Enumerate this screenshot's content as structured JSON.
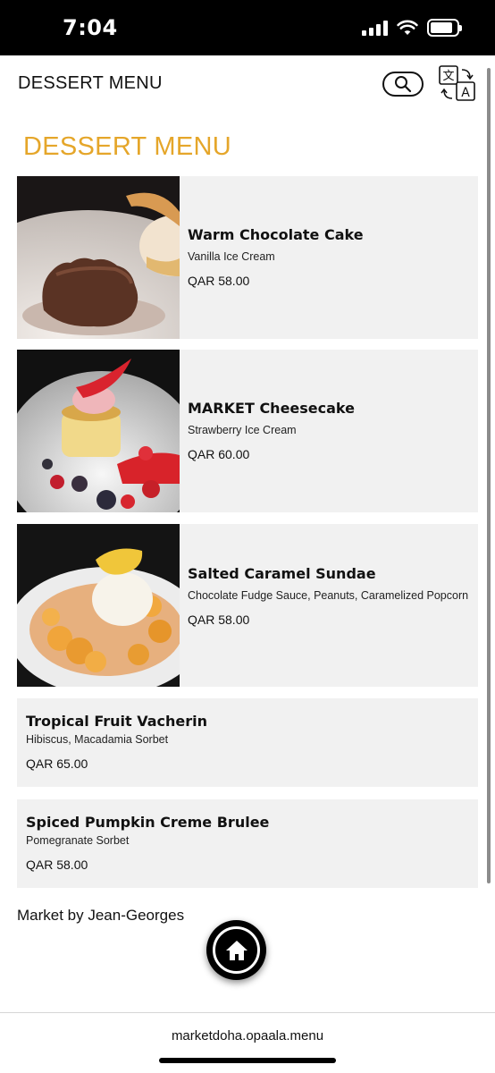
{
  "status_bar": {
    "time": "7:04",
    "battery_level": 0.85
  },
  "header": {
    "title": "DESSERT MENU"
  },
  "section": {
    "title": "DESSERT MENU",
    "accent_color": "#e5a62a"
  },
  "items": [
    {
      "name": "Warm Chocolate Cake",
      "description": "Vanilla Ice Cream",
      "price": "QAR 58.00",
      "image": "chocolate-cake-photo"
    },
    {
      "name": "MARKET Cheesecake",
      "description": "Strawberry Ice Cream",
      "price": "QAR 60.00",
      "image": "cheesecake-photo"
    },
    {
      "name": "Salted Caramel Sundae",
      "description": "Chocolate Fudge Sauce, Peanuts, Caramelized Popcorn",
      "price": "QAR 58.00",
      "image": "sundae-photo"
    },
    {
      "name": "Tropical Fruit Vacherin",
      "description": "Hibiscus, Macadamia Sorbet",
      "price": "QAR 65.00"
    },
    {
      "name": "Spiced Pumpkin Creme Brulee",
      "description": "Pomegranate Sorbet",
      "price": "QAR 58.00"
    }
  ],
  "footer": {
    "brand": "Market by Jean-Georges"
  },
  "browser": {
    "url": "marketdoha.opaala.menu"
  },
  "icons": [
    "search-icon",
    "translate-icon",
    "home-icon",
    "wifi-icon",
    "signal-icon",
    "battery-icon"
  ]
}
